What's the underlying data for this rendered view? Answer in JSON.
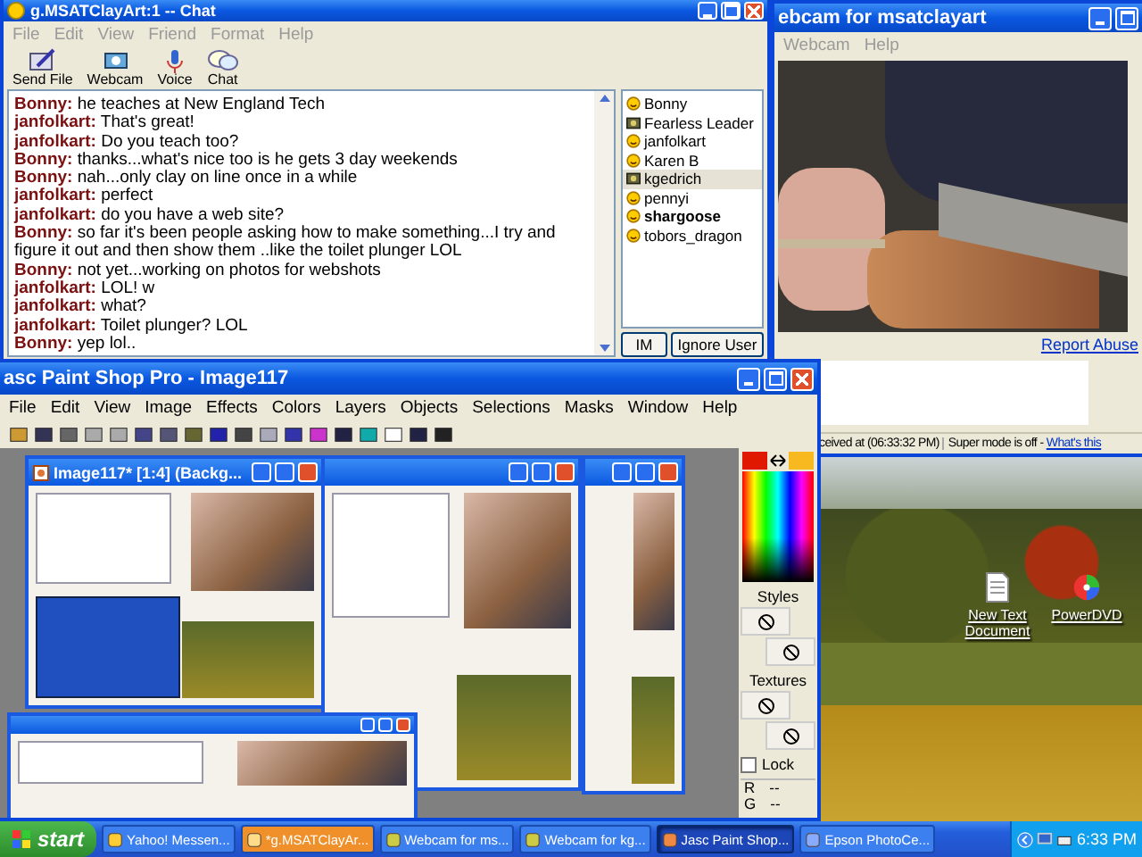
{
  "chat_window": {
    "title": "g.MSATClayArt:1 -- Chat",
    "menu": [
      "File",
      "Edit",
      "View",
      "Friend",
      "Format",
      "Help"
    ],
    "toolbar": [
      {
        "label": "Send File",
        "kind": "file"
      },
      {
        "label": "Webcam",
        "kind": "webcam"
      },
      {
        "label": "Voice",
        "kind": "voice"
      },
      {
        "label": "Chat",
        "kind": "chat"
      }
    ],
    "messages": [
      {
        "sender": "Bonny:",
        "text": "he teaches at New England Tech"
      },
      {
        "sender": "janfolkart:",
        "text": "That's great!"
      },
      {
        "sender": "janfolkart:",
        "text": "Do you teach too?"
      },
      {
        "sender": "Bonny:",
        "text": "thanks...what's nice too is he gets 3 day weekends"
      },
      {
        "sender": "Bonny:",
        "text": "nah...only clay on line once in a while"
      },
      {
        "sender": "janfolkart:",
        "text": "perfect"
      },
      {
        "sender": "janfolkart:",
        "text": "do you have a web site?"
      },
      {
        "sender": "Bonny:",
        "text": "so far it's been people asking how to make something...I try and figure it out and then show them ..like the toilet plunger LOL"
      },
      {
        "sender": "Bonny:",
        "text": "not yet...working on photos for webshots"
      },
      {
        "sender": "janfolkart:",
        "text": "LOL! w"
      },
      {
        "sender": "janfolkart:",
        "text": "what?"
      },
      {
        "sender": "janfolkart:",
        "text": "Toilet plunger? LOL"
      },
      {
        "sender": "Bonny:",
        "text": "yep lol.."
      }
    ],
    "users": [
      {
        "name": "Bonny",
        "kind": "smiley",
        "bold": false,
        "selected": false
      },
      {
        "name": "Fearless Leader",
        "kind": "webcam",
        "bold": false,
        "selected": false
      },
      {
        "name": "janfolkart",
        "kind": "smiley",
        "bold": false,
        "selected": false
      },
      {
        "name": "Karen B",
        "kind": "smiley",
        "bold": false,
        "selected": false
      },
      {
        "name": "kgedrich",
        "kind": "webcam",
        "bold": false,
        "selected": true
      },
      {
        "name": "pennyi",
        "kind": "smiley",
        "bold": false,
        "selected": false
      },
      {
        "name": "shargoose",
        "kind": "smiley",
        "bold": true,
        "selected": false
      },
      {
        "name": "tobors_dragon",
        "kind": "smiley",
        "bold": false,
        "selected": false
      }
    ],
    "buttons": [
      "IM",
      "Ignore User"
    ]
  },
  "webcam_window": {
    "title": "ebcam for msatclayart",
    "menu": [
      "Webcam",
      "Help"
    ],
    "report_link": "Report Abuse",
    "status_received": "ceived at (06:33:32 PM)",
    "status_mode": "Super mode is off -",
    "status_link": "What's this"
  },
  "paint_window": {
    "title": "asc Paint Shop Pro - Image117",
    "menu": [
      "File",
      "Edit",
      "View",
      "Image",
      "Effects",
      "Colors",
      "Layers",
      "Objects",
      "Selections",
      "Masks",
      "Window",
      "Help"
    ],
    "child_window": {
      "title": "Image117* [1:4] (Backg..."
    },
    "palette": {
      "styles_label": "Styles",
      "textures_label": "Textures",
      "lock": {
        "label": "Lock",
        "checked": false
      },
      "readouts": [
        {
          "channel": "R",
          "value": "--"
        },
        {
          "channel": "G",
          "value": "--"
        }
      ]
    }
  },
  "desktop_icons": [
    {
      "label": "New Text Document",
      "kind": "document"
    },
    {
      "label": "PowerDVD",
      "kind": "disc"
    }
  ],
  "taskbar": {
    "start": "start",
    "items": [
      {
        "label": "Yahoo! Messen...",
        "selected": false,
        "flashing": false
      },
      {
        "label": "*g.MSATClayAr...",
        "selected": false,
        "flashing": true
      },
      {
        "label": "Webcam for ms...",
        "selected": false,
        "flashing": false
      },
      {
        "label": "Webcam for kg...",
        "selected": false,
        "flashing": false
      },
      {
        "label": "Jasc Paint Shop...",
        "selected": true,
        "flashing": false
      },
      {
        "label": "Epson PhotoCe...",
        "selected": false,
        "flashing": false
      }
    ],
    "clock": "6:33 PM"
  }
}
